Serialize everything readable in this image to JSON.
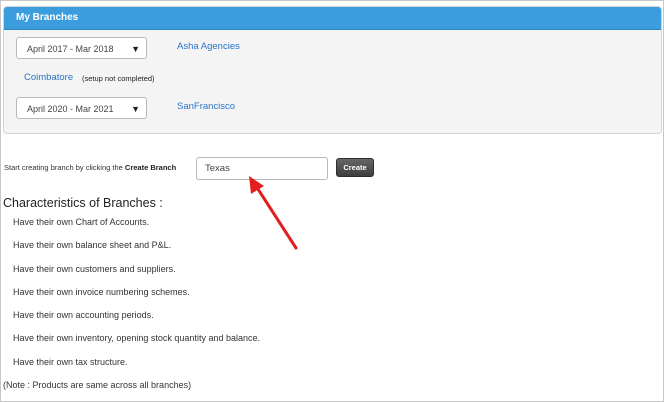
{
  "panel": {
    "title": "My Branches",
    "branches": [
      {
        "period": "April 2017 - Mar 2018",
        "name": "Asha Agencies"
      },
      {
        "name": "Coimbatore",
        "note": "(setup not completed)"
      },
      {
        "period": "April 2020 - Mar 2021",
        "name": "SanFrancisco"
      }
    ]
  },
  "create": {
    "hint_prefix": "Start creating branch by clicking the ",
    "hint_bold": "Create Branch",
    "input_value": "Texas",
    "button_label": "Create"
  },
  "characteristics": {
    "title": "Characteristics of Branches :",
    "items": [
      "Have their own Chart of Accounts.",
      "Have their own balance sheet and P&L.",
      "Have their own customers and suppliers.",
      "Have their own invoice numbering schemes.",
      "Have their own accounting periods.",
      "Have their own inventory, opening stock quantity and balance.",
      "Have their own tax structure."
    ],
    "note": "(Note : Products are same across all branches)"
  },
  "colors": {
    "header": "#3b9ddd",
    "link": "#2a74c9",
    "arrow": "#e02020"
  },
  "icons": {
    "dropdown": "caret-down-icon",
    "annotation": "red-arrow"
  }
}
